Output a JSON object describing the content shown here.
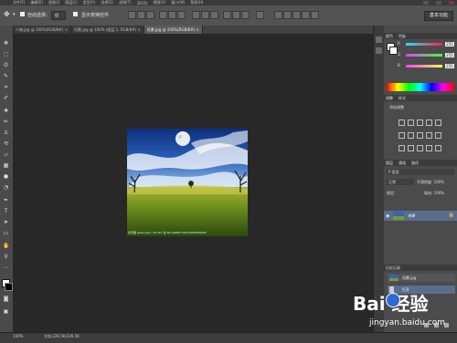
{
  "menubar": {
    "items": [
      "文件(F)",
      "编辑(E)",
      "图像(I)",
      "图层(L)",
      "类型(Y)",
      "选择(S)",
      "滤镜(T)",
      "3D(D)",
      "视图(V)",
      "窗口(W)",
      "帮助(H)"
    ]
  },
  "options": {
    "auto_select_label": "自动选择：",
    "auto_select_value": "组",
    "show_transform_label": "显示变换控件",
    "workspace_button": "基本功能"
  },
  "tabs": [
    {
      "label": "人物.jpg @ 100%(RGB/8#) ×",
      "active": false
    },
    {
      "label": "风景.jpg @ 100% (图层 1, RGB/8#) ×",
      "active": false
    },
    {
      "label": "风景.jpg @ 100%(RGB/8#) × ",
      "active": true
    }
  ],
  "photo": {
    "caption": "风景图 www.nipic.com BY: 谷 No.20080719213054586000"
  },
  "color_panel": {
    "tabs": [
      "颜色",
      "色板"
    ],
    "channels": [
      {
        "label": "R",
        "value": "255",
        "gradient_end": "#ff2040"
      },
      {
        "label": "G",
        "value": "255",
        "gradient_end": "#40ff40"
      },
      {
        "label": "B",
        "value": "255",
        "gradient_end": "#ffff40"
      }
    ]
  },
  "adjust_panel": {
    "tabs": [
      "调整",
      "样式"
    ],
    "title": "添加调整"
  },
  "layers_panel": {
    "tabs": [
      "图层",
      "通道",
      "路径"
    ],
    "kind_label": "P 类型",
    "blend_mode": "正常",
    "opacity_label": "不透明度: 100%",
    "lock_label": "锁定:",
    "fill_label": "填充: 100%",
    "layers": [
      {
        "name": "背景"
      }
    ]
  },
  "history_panel": {
    "tabs": [
      "历史记录"
    ],
    "items": [
      "风景.jpg",
      "打开"
    ]
  },
  "status": {
    "zoom": "100%",
    "doc_info": "文档:226.5K/226.5K"
  },
  "watermark": {
    "brand": "Bai 经验",
    "url": "jingyan.baidu.com"
  }
}
